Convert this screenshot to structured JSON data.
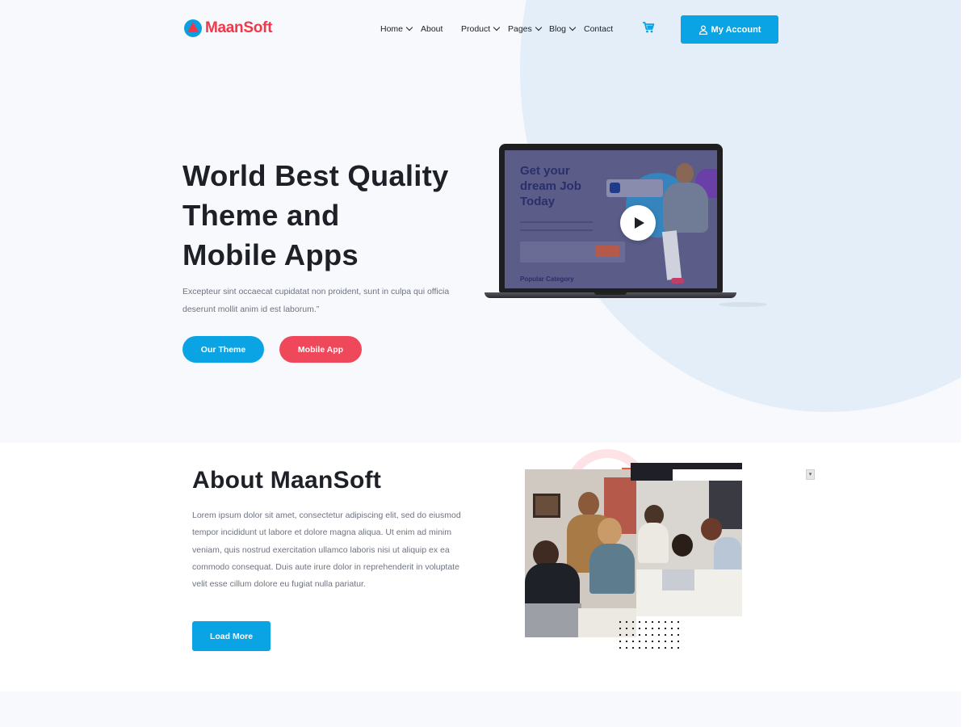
{
  "brand": {
    "name": "MaanSoft",
    "primary": "#0aa3e3",
    "accent": "#f0485b"
  },
  "nav": {
    "items": [
      {
        "label": "Home",
        "dropdown": true
      },
      {
        "label": "About",
        "dropdown": false
      },
      {
        "label": "Product",
        "dropdown": true
      },
      {
        "label": "Pages",
        "dropdown": true
      },
      {
        "label": "Blog",
        "dropdown": true
      },
      {
        "label": "Contact",
        "dropdown": false
      }
    ],
    "cart_icon": "cart-icon",
    "account_label": "My Account"
  },
  "hero": {
    "title_lines": [
      "World Best Quality",
      "Theme and",
      "Mobile Apps"
    ],
    "description": " Excepteur sint occaecat cupidatat non proident, sunt in culpa qui officia deserunt mollit anim id est laborum.”",
    "btn_primary": "Our Theme",
    "btn_secondary": "Mobile App",
    "screen": {
      "headline_lines": [
        "Get your",
        "dream Job",
        "Today"
      ],
      "category": "Popular Category"
    }
  },
  "about": {
    "title": "About MaanSoft",
    "description": " Lorem ipsum dolor sit amet, consectetur adipiscing elit, sed do eiusmod tempor incididunt ut labore et dolore magna aliqua. Ut enim ad minim veniam, quis nostrud exercitation ullamco laboris nisi ut aliquip ex ea commodo consequat. Duis aute irure dolor in reprehenderit in voluptate velit esse cillum dolore eu fugiat nulla pariatur.",
    "btn": "Load More"
  }
}
